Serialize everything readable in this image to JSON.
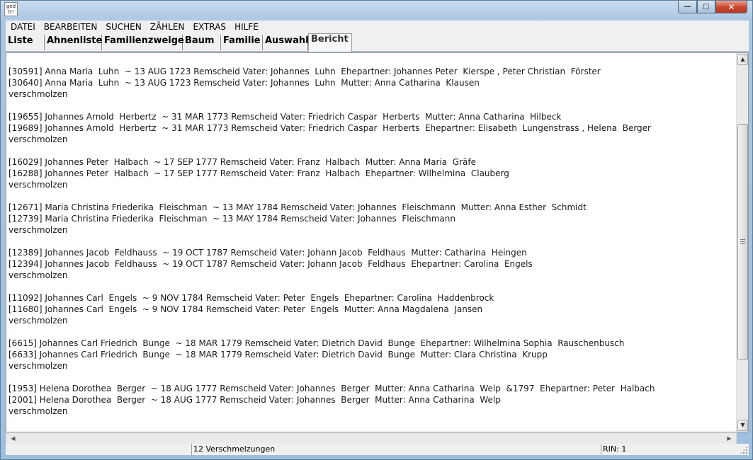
{
  "app": {
    "icon_label": "ged\ntt!"
  },
  "window_controls": {
    "minimize": "—",
    "maximize": "□",
    "close": "✕"
  },
  "menu": [
    "DATEI",
    "BEARBEITEN",
    "SUCHEN",
    "ZÄHLEN",
    "EXTRAS",
    "HILFE"
  ],
  "tabs": [
    {
      "label": "Liste",
      "active": false
    },
    {
      "label": "Ahnenliste",
      "active": false
    },
    {
      "label": "Familienzweige",
      "active": false
    },
    {
      "label": "Baum",
      "active": false
    },
    {
      "label": "Familie",
      "active": false
    },
    {
      "label": "Auswahl",
      "active": false
    },
    {
      "label": "Bericht",
      "active": true
    }
  ],
  "report_lines": [
    "[30591] Anna Maria  Luhn  ~ 13 AUG 1723 Remscheid Vater: Johannes  Luhn  Ehepartner: Johannes Peter  Kierspe , Peter Christian  Förster",
    "[30640] Anna Maria  Luhn  ~ 13 AUG 1723 Remscheid Vater: Johannes  Luhn  Mutter: Anna Catharina  Klausen",
    "verschmolzen",
    "",
    "[19655] Johannes Arnold  Herbertz  ~ 31 MAR 1773 Remscheid Vater: Friedrich Caspar  Herberts  Mutter: Anna Catharina  Hilbeck",
    "[19689] Johannes Arnold  Herbertz  ~ 31 MAR 1773 Remscheid Vater: Friedrich Caspar  Herberts  Ehepartner: Elisabeth  Lungenstrass , Helena  Berger",
    "verschmolzen",
    "",
    "[16029] Johannes Peter  Halbach  ~ 17 SEP 1777 Remscheid Vater: Franz  Halbach  Mutter: Anna Maria  Gräfe",
    "[16288] Johannes Peter  Halbach  ~ 17 SEP 1777 Remscheid Vater: Franz  Halbach  Ehepartner: Wilhelmina  Clauberg",
    "verschmolzen",
    "",
    "[12671] Maria Christina Friederika  Fleischman  ~ 13 MAY 1784 Remscheid Vater: Johannes  Fleischmann  Mutter: Anna Esther  Schmidt",
    "[12739] Maria Christina Friederika  Fleischman  ~ 13 MAY 1784 Remscheid Vater: Johannes  Fleischmann",
    "verschmolzen",
    "",
    "[12389] Johannes Jacob  Feldhauss  ~ 19 OCT 1787 Remscheid Vater: Johann Jacob  Feldhaus  Mutter: Catharina  Heingen",
    "[12394] Johannes Jacob  Feldhauss  ~ 19 OCT 1787 Remscheid Vater: Johann Jacob  Feldhaus  Ehepartner: Carolina  Engels",
    "verschmolzen",
    "",
    "[11092] Johannes Carl  Engels  ~ 9 NOV 1784 Remscheid Vater: Peter  Engels  Ehepartner: Carolina  Haddenbrock",
    "[11680] Johannes Carl  Engels  ~ 9 NOV 1784 Remscheid Vater: Peter  Engels  Mutter: Anna Magdalena  Jansen",
    "verschmolzen",
    "",
    "[6615] Johannes Carl Friedrich  Bunge  ~ 18 MAR 1779 Remscheid Vater: Dietrich David  Bunge  Ehepartner: Wilhelmina Sophia  Rauschenbusch",
    "[6633] Johannes Carl Friedrich  Bunge  ~ 18 MAR 1779 Remscheid Vater: Dietrich David  Bunge  Mutter: Clara Christina  Krupp",
    "verschmolzen",
    "",
    "[1953] Helena Dorothea  Berger  ~ 18 AUG 1777 Remscheid Vater: Johannes  Berger  Mutter: Anna Catharina  Welp  &1797  Ehepartner: Peter  Halbach",
    "[2001] Helena Dorothea  Berger  ~ 18 AUG 1777 Remscheid Vater: Johannes  Berger  Mutter: Anna Catharina  Welp",
    "verschmolzen"
  ],
  "status": {
    "left": "",
    "merge_count": "12 Verschmelzungen",
    "rin": "RIN: 1"
  },
  "colors": {
    "frame": "#9dbfdf",
    "close_button": "#c8452c"
  }
}
